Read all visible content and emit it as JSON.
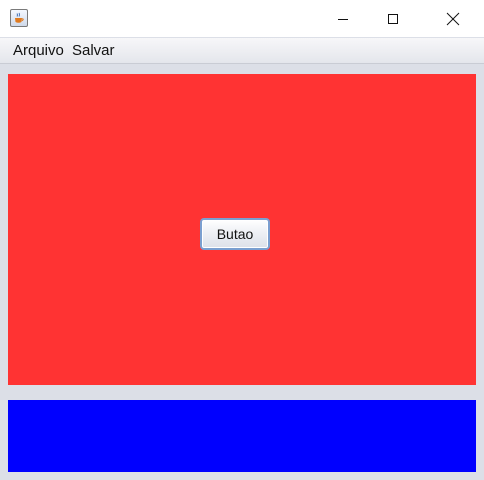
{
  "window": {
    "title": "",
    "icon": "java-cup-icon",
    "controls": [
      "minimize-icon",
      "maximize-icon",
      "close-icon"
    ]
  },
  "menubar": {
    "items": [
      {
        "label": "Arquivo"
      },
      {
        "label": "Salvar"
      }
    ]
  },
  "content": {
    "top_panel_color": "#ff3333",
    "bottom_panel_color": "#0000ff",
    "button_label": "Butao"
  }
}
